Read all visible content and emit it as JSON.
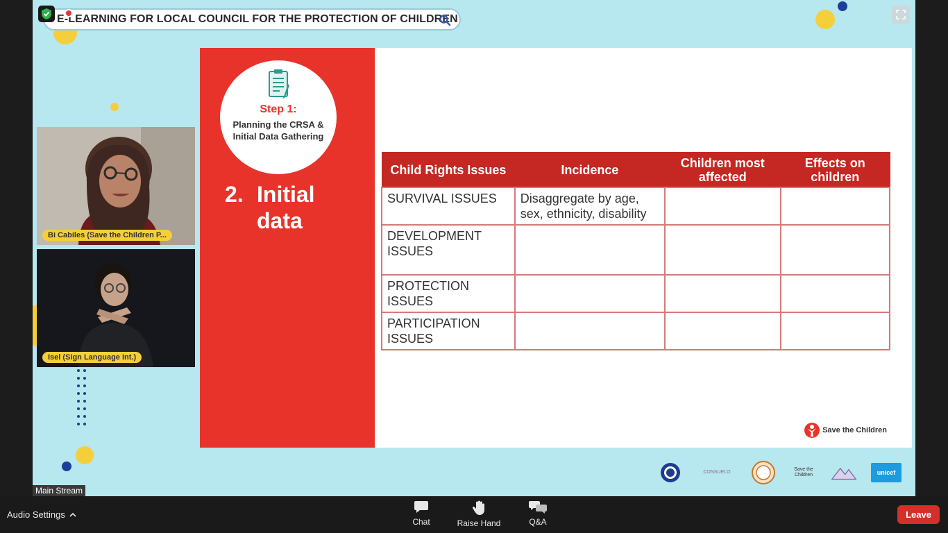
{
  "stream": {
    "banner_title": "E-LEARNING FOR LOCAL COUNCIL FOR THE PROTECTION OF CHILDREN",
    "label": "Main Stream"
  },
  "slide": {
    "step_label": "Step 1:",
    "step_desc": "Planning the CRSA & Initial Data Gathering",
    "heading_num": "2.",
    "heading_line1": "Initial",
    "heading_line2": "data",
    "table": {
      "headers": [
        "Child Rights Issues",
        "Incidence",
        "Children most affected",
        "Effects on children"
      ],
      "rows": [
        [
          "SURVIVAL ISSUES",
          "Disaggregate by age, sex, ethnicity, disability",
          "",
          ""
        ],
        [
          "DEVELOPMENT ISSUES",
          "",
          "",
          ""
        ],
        [
          "PROTECTION ISSUES",
          "",
          "",
          ""
        ],
        [
          "PARTICIPATION ISSUES",
          "",
          "",
          ""
        ]
      ]
    },
    "brand": "Save the Children"
  },
  "partners": [
    "CONSUELO",
    "Save the Children",
    "unicef"
  ],
  "participants": [
    {
      "name": "Bi Cabiles (Save the Children P..."
    },
    {
      "name": "Isel (Sign Language Int.)"
    }
  ],
  "toolbar": {
    "audio_settings": "Audio Settings",
    "chat": "Chat",
    "raise_hand": "Raise Hand",
    "qa": "Q&A",
    "leave": "Leave"
  },
  "colors": {
    "slide_red": "#e8332b",
    "table_header": "#c52722",
    "leave_button": "#d3302a",
    "stream_bg": "#b7e7ef"
  }
}
